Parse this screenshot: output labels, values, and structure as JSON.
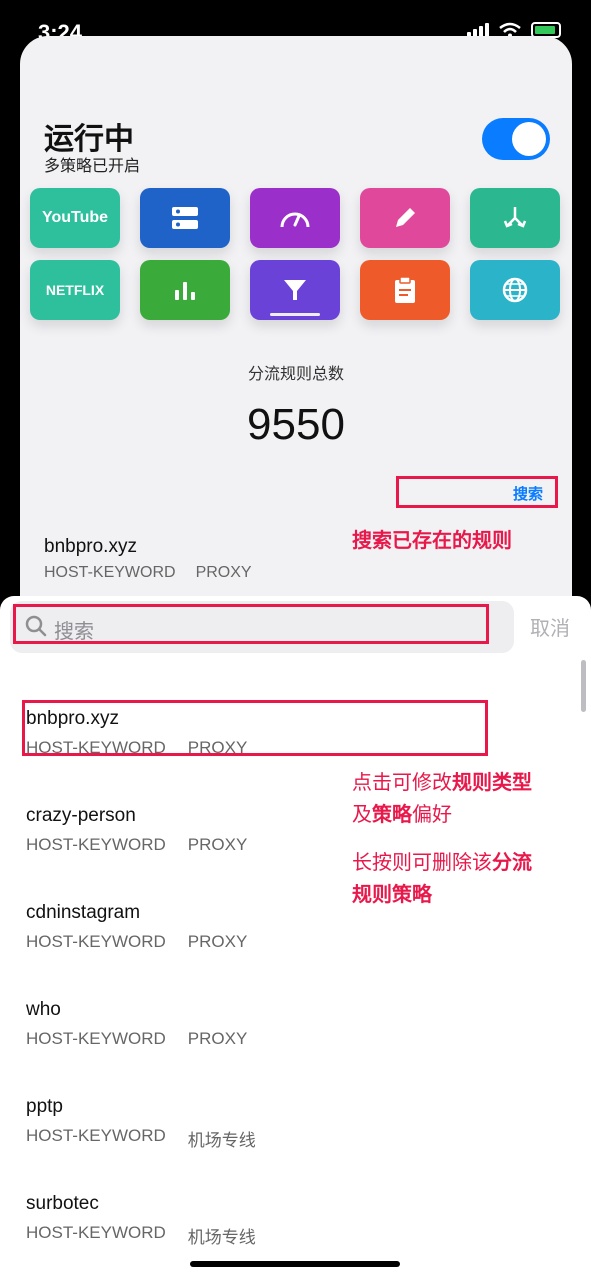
{
  "status_bar": {
    "time": "3:24"
  },
  "header": {
    "title": "运行中",
    "subtitle": "多策略已开启"
  },
  "tiles": [
    {
      "label": "YouTube",
      "color": "#2ebf9d",
      "icon": "youtube-logo"
    },
    {
      "label": "",
      "color": "#1f62c8",
      "icon": "server-icon"
    },
    {
      "label": "",
      "color": "#9b2fc9",
      "icon": "speedometer-icon"
    },
    {
      "label": "",
      "color": "#e0489c",
      "icon": "pencil-icon"
    },
    {
      "label": "",
      "color": "#2bb890",
      "icon": "fork-arrow-icon"
    },
    {
      "label": "NETFLIX",
      "color": "#2ebf9d",
      "icon": "netflix-logo"
    },
    {
      "label": "",
      "color": "#3aaa3a",
      "icon": "bar-chart-icon"
    },
    {
      "label": "",
      "color": "#6a42d8",
      "icon": "filter-icon"
    },
    {
      "label": "",
      "color": "#ee5a2a",
      "icon": "clipboard-icon"
    },
    {
      "label": "",
      "color": "#2ab3c9",
      "icon": "globe-icon"
    }
  ],
  "stats": {
    "label": "分流规则总数",
    "count": "9550",
    "search_link": "搜索"
  },
  "annotations": {
    "search_existing": "搜索已存在的规则",
    "tap_line1_a": "点击可修改",
    "tap_line1_b": "规则类型",
    "tap_line2_a": "及",
    "tap_line2_b": "策略",
    "tap_line2_c": "偏好",
    "hold_line1_a": "长按则可删除该",
    "hold_line1_b": "分流",
    "hold_line2": "规则策略"
  },
  "background_rule": {
    "name": "bnbpro.xyz",
    "type": "HOST-KEYWORD",
    "policy": "PROXY"
  },
  "search": {
    "placeholder": "搜索",
    "cancel_label": "取消"
  },
  "rules": [
    {
      "name": "bnbpro.xyz",
      "type": "HOST-KEYWORD",
      "policy": "PROXY"
    },
    {
      "name": "crazy-person",
      "type": "HOST-KEYWORD",
      "policy": "PROXY"
    },
    {
      "name": "cdninstagram",
      "type": "HOST-KEYWORD",
      "policy": "PROXY"
    },
    {
      "name": "who",
      "type": "HOST-KEYWORD",
      "policy": "PROXY"
    },
    {
      "name": "pptp",
      "type": "HOST-KEYWORD",
      "policy": "机场专线"
    },
    {
      "name": "surbotec",
      "type": "HOST-KEYWORD",
      "policy": "机场专线"
    }
  ],
  "colors": {
    "accent": "#0a7cff",
    "annotation": "#e8184a"
  }
}
